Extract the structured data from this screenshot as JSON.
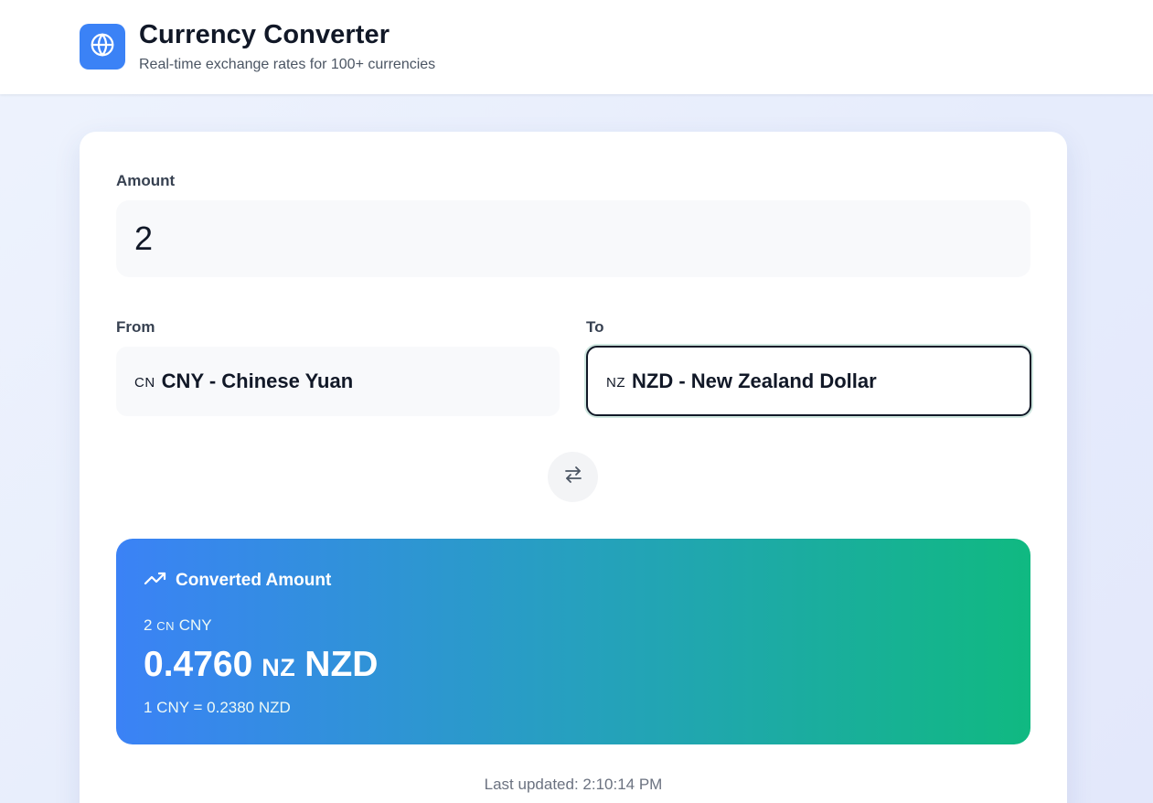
{
  "header": {
    "title": "Currency Converter",
    "subtitle": "Real-time exchange rates for 100+ currencies",
    "logo_icon": "globe-icon"
  },
  "form": {
    "amount_label": "Amount",
    "amount_value": "2",
    "from_label": "From",
    "to_label": "To",
    "from": {
      "flag": "CN",
      "text": "CNY - Chinese Yuan"
    },
    "to": {
      "flag": "NZ",
      "text": "NZD - New Zealand Dollar"
    },
    "swap_icon": "swap-arrows-icon"
  },
  "result": {
    "heading": "Converted Amount",
    "heading_icon": "trending-up-icon",
    "from_amount": "2",
    "from_flag": "CN",
    "from_code": "CNY",
    "converted_value": "0.4760",
    "to_flag": "NZ",
    "to_code": "NZD",
    "rate_text": "1 CNY = 0.2380 NZD"
  },
  "footer": {
    "last_updated": "Last updated: 2:10:14 PM"
  },
  "colors": {
    "accent": "#3b82f6",
    "gradient_start": "#3b82f6",
    "gradient_end": "#10b981"
  }
}
